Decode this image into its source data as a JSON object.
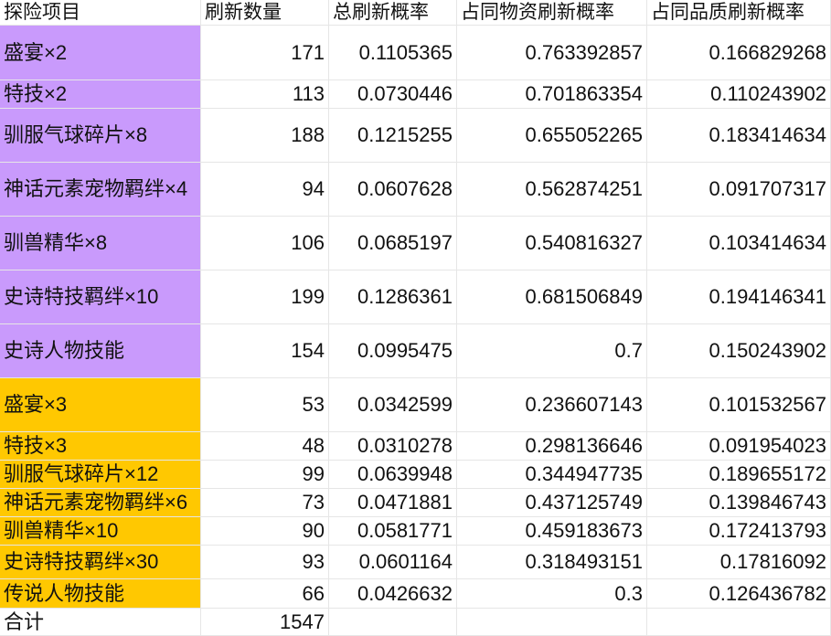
{
  "table": {
    "headers": [
      "探险项目",
      "刷新数量",
      "总刷新概率",
      "占同物资刷新概率",
      "占同品质刷新概率"
    ],
    "rows": [
      {
        "item": "盛宴×2",
        "count": "171",
        "total": "0.1105365",
        "same_res": "0.763392857",
        "same_q": "0.166829268",
        "group": "purple"
      },
      {
        "item": "特技×2",
        "count": "113",
        "total": "0.0730446",
        "same_res": "0.701863354",
        "same_q": "0.110243902",
        "group": "purple"
      },
      {
        "item": "驯服气球碎片×8",
        "count": "188",
        "total": "0.1215255",
        "same_res": "0.655052265",
        "same_q": "0.183414634",
        "group": "purple"
      },
      {
        "item": "神话元素宠物羁绊×4",
        "count": "94",
        "total": "0.0607628",
        "same_res": "0.562874251",
        "same_q": "0.091707317",
        "group": "purple"
      },
      {
        "item": "驯兽精华×8",
        "count": "106",
        "total": "0.0685197",
        "same_res": "0.540816327",
        "same_q": "0.103414634",
        "group": "purple"
      },
      {
        "item": "史诗特技羁绊×10",
        "count": "199",
        "total": "0.1286361",
        "same_res": "0.681506849",
        "same_q": "0.194146341",
        "group": "purple"
      },
      {
        "item": "史诗人物技能",
        "count": "154",
        "total": "0.0995475",
        "same_res": "0.7",
        "same_q": "0.150243902",
        "group": "purple"
      },
      {
        "item": "盛宴×3",
        "count": "53",
        "total": "0.0342599",
        "same_res": "0.236607143",
        "same_q": "0.101532567",
        "group": "gold"
      },
      {
        "item": "特技×3",
        "count": "48",
        "total": "0.0310278",
        "same_res": "0.298136646",
        "same_q": "0.091954023",
        "group": "gold"
      },
      {
        "item": "驯服气球碎片×12",
        "count": "99",
        "total": "0.0639948",
        "same_res": "0.344947735",
        "same_q": "0.189655172",
        "group": "gold"
      },
      {
        "item": "神话元素宠物羁绊×6",
        "count": "73",
        "total": "0.0471881",
        "same_res": "0.437125749",
        "same_q": "0.139846743",
        "group": "gold"
      },
      {
        "item": "驯兽精华×10",
        "count": "90",
        "total": "0.0581771",
        "same_res": "0.459183673",
        "same_q": "0.172413793",
        "group": "gold"
      },
      {
        "item": "史诗特技羁绊×30",
        "count": "93",
        "total": "0.0601164",
        "same_res": "0.318493151",
        "same_q": "0.17816092",
        "group": "gold"
      },
      {
        "item": "传说人物技能",
        "count": "66",
        "total": "0.0426632",
        "same_res": "0.3",
        "same_q": "0.126436782",
        "group": "gold"
      }
    ],
    "footer": {
      "label": "合计",
      "count": "1547"
    }
  },
  "colors": {
    "purple": "#c99afc",
    "gold": "#ffc801",
    "grid": "#e6e6e6"
  }
}
